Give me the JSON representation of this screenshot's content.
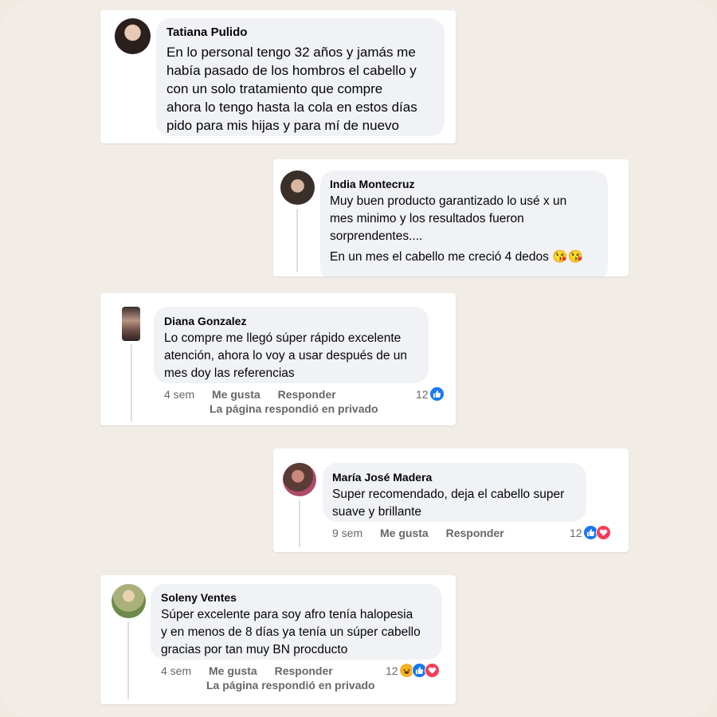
{
  "comments": [
    {
      "name": "Tatiana Pulido",
      "text": "En lo personal tengo 32 años y jamás me\nhabía pasado de los hombros el cabello y\ncon un solo tratamiento que compre\nahora lo tengo hasta la cola en estos días\npido para mis hijas y para mí de nuevo"
    },
    {
      "name": "India Montecruz",
      "text": "Muy buen producto garantizado lo usé x un\nmes minimo y los resultados fueron\nsorprendentes....",
      "text2": "En un mes el cabello me creció 4 dedos 😘😘"
    },
    {
      "name": "Diana Gonzalez",
      "text": "Lo compre me llegó súper rápido excelente\natención, ahora lo voy a usar después de un\nmes doy las referencias",
      "time": "4 sem",
      "like_label": "Me gusta",
      "reply_label": "Responder",
      "reaction_count": "12",
      "reactions": [
        "like-icon"
      ],
      "private_reply": "La página respondió en privado"
    },
    {
      "name": "María José Madera",
      "text": "Super recomendado, deja el cabello super\nsuave y brillante",
      "time": "9 sem",
      "like_label": "Me gusta",
      "reply_label": "Responder",
      "reaction_count": "12",
      "reactions": [
        "like-icon",
        "love-icon"
      ]
    },
    {
      "name": "Soleny Ventes",
      "text": "Súper excelente para soy afro tenía halopesia\ny en menos de 8 días ya tenía un súper cabello\ngracias por tan muy BN procducto",
      "time": "4 sem",
      "like_label": "Me gusta",
      "reply_label": "Responder",
      "reaction_count": "12",
      "reactions": [
        "haha-icon",
        "like-icon",
        "love-icon"
      ],
      "private_reply": "La página respondió en privado"
    }
  ],
  "colors": {
    "background": "#efebe3",
    "bubble": "#f0f2f5",
    "meta_text": "#65676b",
    "like_blue": "#1877f2",
    "love_red": "#f33e58",
    "haha_yellow": "#f7b125"
  }
}
